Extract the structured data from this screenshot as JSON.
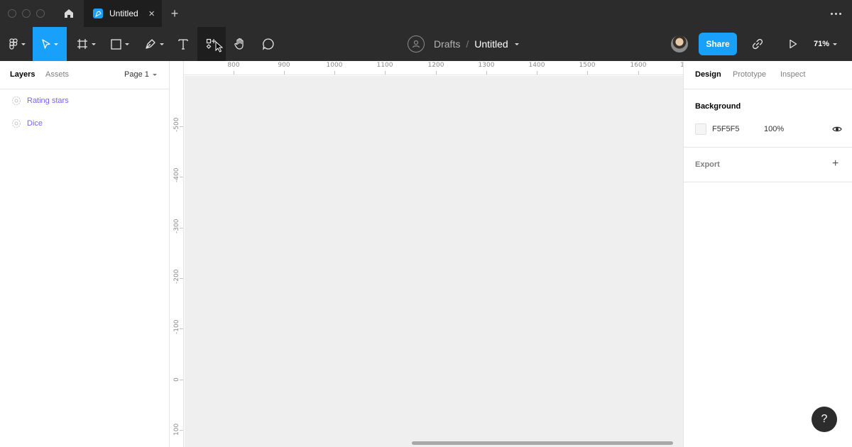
{
  "tabbar": {
    "home_icon": "home-icon",
    "tab_title": "Untitled",
    "close_glyph": "×",
    "new_tab_glyph": "+",
    "more_icon": "ellipsis-icon"
  },
  "toolbar": {
    "tools": [
      "main-menu",
      "move",
      "frame",
      "shape",
      "pen",
      "text",
      "resources",
      "hand",
      "comment"
    ],
    "breadcrumb": {
      "drafts": "Drafts",
      "separator": "/",
      "file": "Untitled"
    },
    "share_label": "Share",
    "zoom": "71%"
  },
  "left_panel": {
    "tabs": [
      "Layers",
      "Assets"
    ],
    "page_selector": "Page 1",
    "layers": [
      {
        "name": "Rating stars",
        "icon": "component-icon"
      },
      {
        "name": "Dice",
        "icon": "component-icon"
      }
    ]
  },
  "rulers": {
    "x_ticks": [
      "800",
      "900",
      "1000",
      "1100",
      "1200",
      "1300",
      "1400",
      "1500",
      "1600",
      "1"
    ],
    "y_ticks": [
      "-500",
      "-400",
      "-300",
      "-200",
      "-100",
      "0",
      "100"
    ]
  },
  "right_panel": {
    "tabs": [
      "Design",
      "Prototype",
      "Inspect"
    ],
    "background": {
      "title": "Background",
      "hex": "F5F5F5",
      "opacity": "100%",
      "swatch_color": "#F5F5F5"
    },
    "export": {
      "title": "Export",
      "add_glyph": "+"
    }
  },
  "help_glyph": "?",
  "colors": {
    "accent": "#18a0fb",
    "chrome": "#2c2c2c",
    "component_purple": "#7b61ff",
    "canvas": "#efefef"
  }
}
